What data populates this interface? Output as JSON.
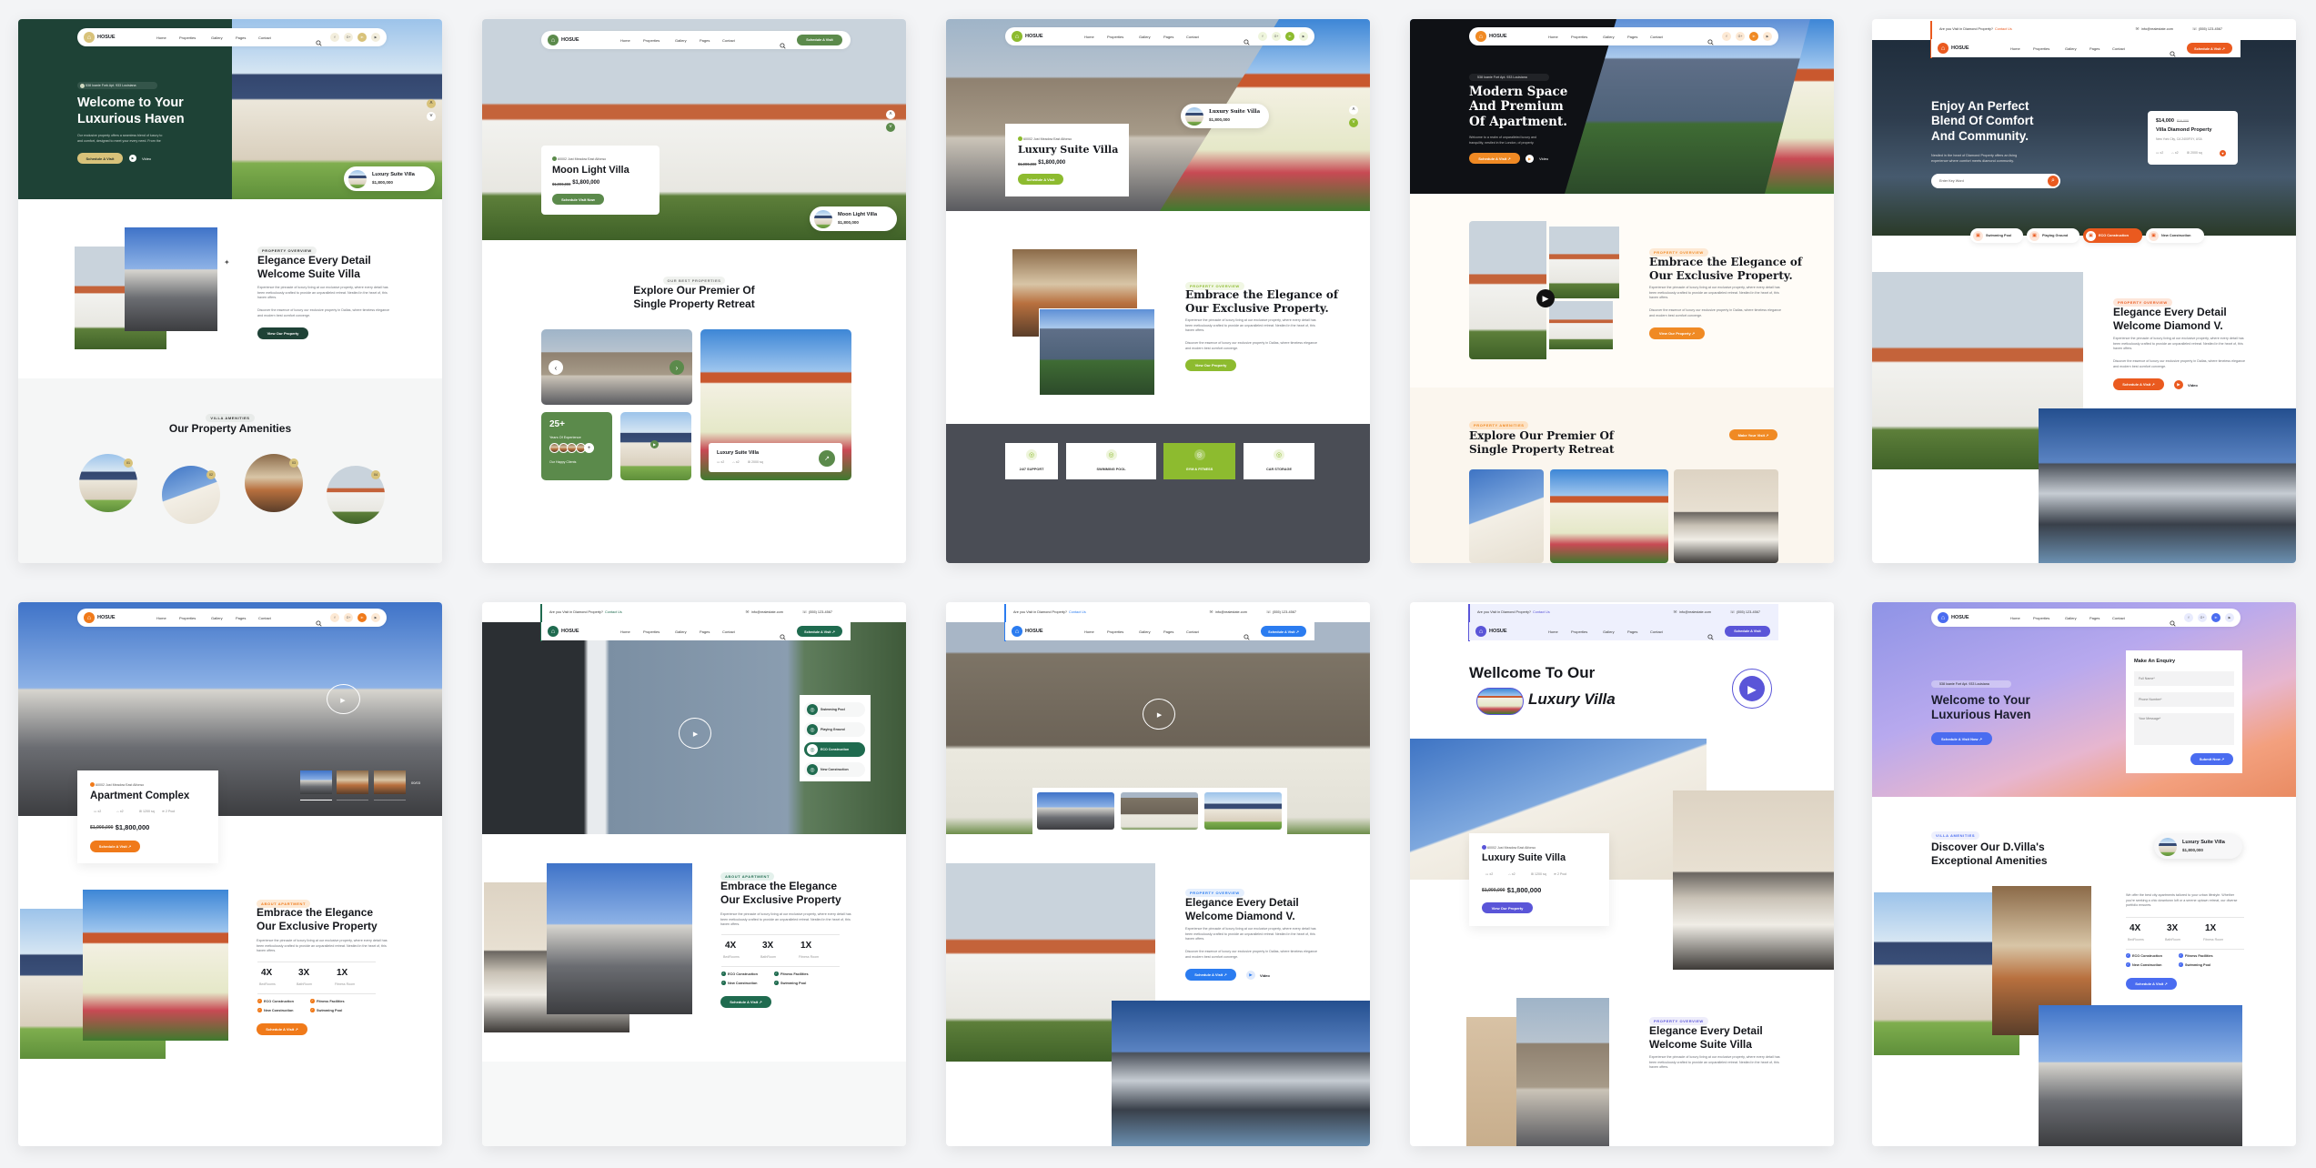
{
  "nav": {
    "logo": "HOSUE",
    "items": [
      "Home",
      "Properties",
      "Gallery",
      "Pages",
      "Contact"
    ],
    "social": [
      "f",
      "G+",
      "in",
      "▶"
    ]
  },
  "topbar": {
    "question": "Are you Visit in Diamond Property?",
    "contact": "Contact Us",
    "email": "info@realestate.com",
    "phone": "(555) 123-4567"
  },
  "icons": {
    "search": "search-icon",
    "logo": "home-icon",
    "play": "play-icon",
    "arrow": "arrow-up-right-icon",
    "check": "check-circle-icon"
  },
  "cards": [
    {
      "theme": {
        "accent": "#d8c27a",
        "dark": "#1e4236"
      },
      "hero": {
        "address": "538 Ioanie Fork Apt. 933 Louisiana",
        "title": "Welcome to Your\nLuxurious Haven",
        "description": "Our exclusive property offers a seamless blend of luxury to\nand comfort, designed to meet your every need. From the",
        "primary_button": "Schedule A Visit",
        "video_label": "Video"
      },
      "float_card": {
        "title": "Luxury Suite Villa",
        "price": "$1,800,000"
      },
      "overview": {
        "tag": "PROPERTY OVERVIEW",
        "heading": "Elegance Every Detail\nWelcome Suite Villa",
        "paragraphs": [
          "Experience the pinnacle of luxury living at our exclusive property, where every detail has been meticulously crafted to provide an unparalleled retreat. Nestled in the heart of, this haven offers.",
          "Discover the essence of luxury our exclusive property in Dallas, where timeless elegance and modern best comfort converge."
        ],
        "button": "View Our Property"
      },
      "amenities": {
        "tag": "VILLA AMENITIES",
        "heading": "Our Property Amenities",
        "badges": [
          "01",
          "02",
          "03",
          "04"
        ]
      }
    },
    {
      "theme": {
        "accent": "#5b8a4b"
      },
      "nav_button": "Schedule A Visit",
      "hero": {
        "address": "60002 Just Meadow East Alfonso",
        "title": "Moon Light Villa",
        "old_price": "$1,900,000",
        "price": "$1,800,000",
        "button": "Schedule Visit Now"
      },
      "float_card": {
        "title": "Moon Light Villa",
        "price": "$1,800,000"
      },
      "properties": {
        "tag": "OUR BEST PROPERTIES",
        "heading": "Explore Our Premier Of\nSingle Property Retreat",
        "experience_value": "25+",
        "experience_label": "Years Of Experience",
        "clients_label": "Our Happy Clients",
        "featured_title": "Luxury Suite Villa",
        "specs": [
          "x2",
          "x2",
          "2000 sq"
        ]
      }
    },
    {
      "theme": {
        "accent": "#8dbb2f"
      },
      "hero": {
        "address": "60002 Just Meadow East Alfonso",
        "title": "Luxury Suite Villa",
        "old_price": "$1,900,000",
        "price": "$1,800,000",
        "button": "Schedule A Visit"
      },
      "float_card": {
        "title": "Luxury Suite Villa",
        "price": "$1,800,000"
      },
      "overview": {
        "tag": "PROPERTY OVERVIEW",
        "heading": "Embrace the Elegance of\nOur Exclusive Property.",
        "paragraphs": [
          "Experience the pinnacle of luxury living at our exclusive property, where every detail has been meticulously crafted to provide an unparalleled retreat. Nestled in the heart of, this haven offers.",
          "Discover the essence of luxury our exclusive property in Dallas, where timeless elegance and modern best comfort converge."
        ],
        "button": "View Our Property"
      },
      "services": [
        {
          "label": "24/7 SUPPORT",
          "active": false
        },
        {
          "label": "SWIMMING POOL",
          "active": false
        },
        {
          "label": "GYM & FITNESS",
          "active": true
        },
        {
          "label": "CAR STORAGE",
          "active": false
        }
      ]
    },
    {
      "theme": {
        "accent": "#f08a24"
      },
      "hero": {
        "address": "538 Ioanie Fort Apt. 933 Louisiana",
        "title": "Modern Space\nAnd Premium\nOf Apartment.",
        "description": "Welcome to a realm of unparalleled luxury and\ntranquility, nestled in the London, of property.",
        "primary_button": "Schedule A Visit ↗",
        "video_label": "Video"
      },
      "overview": {
        "tag": "PROPERTY OVERVIEW",
        "heading": "Embrace the Elegance of\nOur Exclusive Property.",
        "paragraphs": [
          "Experience the pinnacle of luxury living at our exclusive property, where every detail has been meticulously crafted to provide an unparalleled retreat. Nestled in the heart of, this haven offers.",
          "Discover the essence of luxury our exclusive property in Dallas, where timeless elegance and modern best comfort converge."
        ],
        "button": "View Our Property ↗"
      },
      "amenities": {
        "tag": "PROPERTY AMENITIES",
        "heading": "Explore Our Premier Of\nSingle Property Retreat",
        "button": "Make Your Visit ↗"
      }
    },
    {
      "theme": {
        "accent": "#ea5a1f"
      },
      "nav_button": "Schedule A Visit ↗",
      "hero": {
        "title": "Enjoy An Perfect\nBlend Of Comfort\nAnd Community.",
        "description": "Nestled in the heart of Diamond Property offers an living\nexperience where comfort meets diamond community.",
        "search_placeholder": "Enter Key Word"
      },
      "listing": {
        "price": "$14,000",
        "old_price": "$16,000",
        "title": "Villa Diamond Property",
        "location": "New York City, CA 2400FXY, USA",
        "specs": [
          "x2",
          "x2",
          "2000 sq"
        ]
      },
      "features": [
        {
          "label": "Swimming Pool",
          "active": false
        },
        {
          "label": "Playing Ground",
          "active": false
        },
        {
          "label": "ECO Construction",
          "active": true
        },
        {
          "label": "New Construction",
          "active": false
        }
      ],
      "overview": {
        "tag": "PROPERTY OVERVIEW",
        "heading": "Elegance Every Detail\nWelcome Diamond V.",
        "paragraphs": [
          "Experience the pinnacle of luxury living at our exclusive property, where every detail has been meticulously crafted to provide an unparalleled retreat. Nestled in the heart of, this haven offers.",
          "Discover the essence of luxury our exclusive property in Dallas, where timeless elegance and modern best comfort converge."
        ],
        "button": "Schedule A Visit ↗",
        "video_label": "Video"
      }
    },
    {
      "theme": {
        "accent": "#f07a1a"
      },
      "hero": {
        "address": "60002 Just Meadow East Alfonso",
        "title": "Apartment Complex",
        "specs": [
          "x2",
          "x2",
          "1200 sq",
          "2 Pool"
        ],
        "old_price": "$1,900,000",
        "price": "$1,800,000",
        "button": "Schedule A Visit ↗",
        "slide_counter": "00/03"
      },
      "about": {
        "tag": "ABOUT APARTMENT",
        "heading": "Embrace the Elegance\nOur Exclusive Property",
        "paragraph": "Experience the pinnacle of luxury living at our exclusive property, where every detail has been meticulously crafted to provide an unparalleled retreat. Nestled in the heart of, this haven offers.",
        "stats": [
          {
            "value": "4X",
            "label": "BedRooms"
          },
          {
            "value": "3X",
            "label": "BathRoom"
          },
          {
            "value": "1X",
            "label": "Fitness Room"
          }
        ],
        "features": [
          "ECO Construction",
          "Fitness Facilities",
          "New Construction",
          "Swimming Pool"
        ],
        "button": "Schedule A Visit ↗"
      }
    },
    {
      "theme": {
        "accent": "#1f6b4f"
      },
      "nav_button": "Schedule A Visit ↗",
      "hero": {
        "amenities": [
          {
            "label": "Swimming Pool",
            "active": false
          },
          {
            "label": "Playing Ground",
            "active": false
          },
          {
            "label": "ECO Construction",
            "active": true
          },
          {
            "label": "New Construction",
            "active": false
          }
        ]
      },
      "about": {
        "tag": "ABOUT APARTMENT",
        "heading": "Embrace the Elegance\nOur Exclusive Property",
        "paragraph": "Experience the pinnacle of luxury living at our exclusive property, where every detail has been meticulously crafted to provide an unparalleled retreat. Nestled in the heart of, this haven offers.",
        "stats": [
          {
            "value": "4X",
            "label": "BedRooms"
          },
          {
            "value": "3X",
            "label": "BathRoom"
          },
          {
            "value": "1X",
            "label": "Fitness Room"
          }
        ],
        "features": [
          "ECO Construction",
          "Fitness Facilities",
          "New Construction",
          "Swimming Pool"
        ],
        "button": "Schedule A Visit ↗"
      }
    },
    {
      "theme": {
        "accent": "#2b7cf0"
      },
      "nav_button": "Schedule A Visit ↗",
      "overview": {
        "tag": "PROPERTY OVERVIEW",
        "heading": "Elegance Every Detail\nWelcome Diamond V.",
        "paragraphs": [
          "Experience the pinnacle of luxury living at our exclusive property, where every detail has been meticulously crafted to provide an unparalleled retreat. Nestled in the heart of, this haven offers.",
          "Discover the essence of luxury our exclusive property in Dallas, where timeless elegance and modern best comfort converge."
        ],
        "button": "Schedule A Visit ↗",
        "video_label": "Video"
      }
    },
    {
      "theme": {
        "accent": "#5a55d8"
      },
      "nav_button": "Schedule A Visit",
      "hero": {
        "title_line1": "Wellcome To Our",
        "title_line2": "Luxury Villa"
      },
      "listing": {
        "address": "60002 Just Meadow East Alfonso",
        "title": "Luxury Suite Villa",
        "specs": [
          "x2",
          "x2",
          "1200 sq",
          "2 Pool"
        ],
        "old_price": "$1,900,000",
        "price": "$1,800,000",
        "button": "View Our Property"
      },
      "overview": {
        "tag": "PROPERTY OVERVIEW",
        "heading": "Elegance Every Detail\nWelcome Suite Villa",
        "paragraph": "Experience the pinnacle of luxury living at our exclusive property, where every detail has been meticulously crafted to provide an unparalleled retreat. Nestled in the heart of, this haven offers."
      }
    },
    {
      "theme": {
        "accent": "#4a6cf0"
      },
      "hero": {
        "address": "538 Ioanie Fort Apt. 933 Louisiana",
        "title": "Welcome to Your\nLuxurious Haven",
        "button": "Schedule A Visit Now ↗"
      },
      "enquiry": {
        "title": "Make An Enquiry",
        "name_placeholder": "Full Name*",
        "phone_placeholder": "Phone Number*",
        "message_placeholder": "Your Message*",
        "submit": "Submit Now ↗"
      },
      "amenities": {
        "tag": "VILLA AMENITIES",
        "heading": "Discover Our D.Villa's\nExceptional Amenities",
        "float_title": "Luxury Suite Villa",
        "float_price": "$1,800,000",
        "paragraph": "We offer the best city apartments tailored to your urban lifestyle. Whether you're seeking a chic downtown loft or a serene uptown retreat, our diverse portfolio ensures.",
        "stats": [
          {
            "value": "4X",
            "label": "BedRooms"
          },
          {
            "value": "3X",
            "label": "BathRoom"
          },
          {
            "value": "1X",
            "label": "Fitness Room"
          }
        ],
        "features": [
          "ECO Construction",
          "Fitness Facilities",
          "New Construction",
          "Swimming Pool"
        ],
        "button": "Schedule A Visit ↗"
      }
    }
  ]
}
